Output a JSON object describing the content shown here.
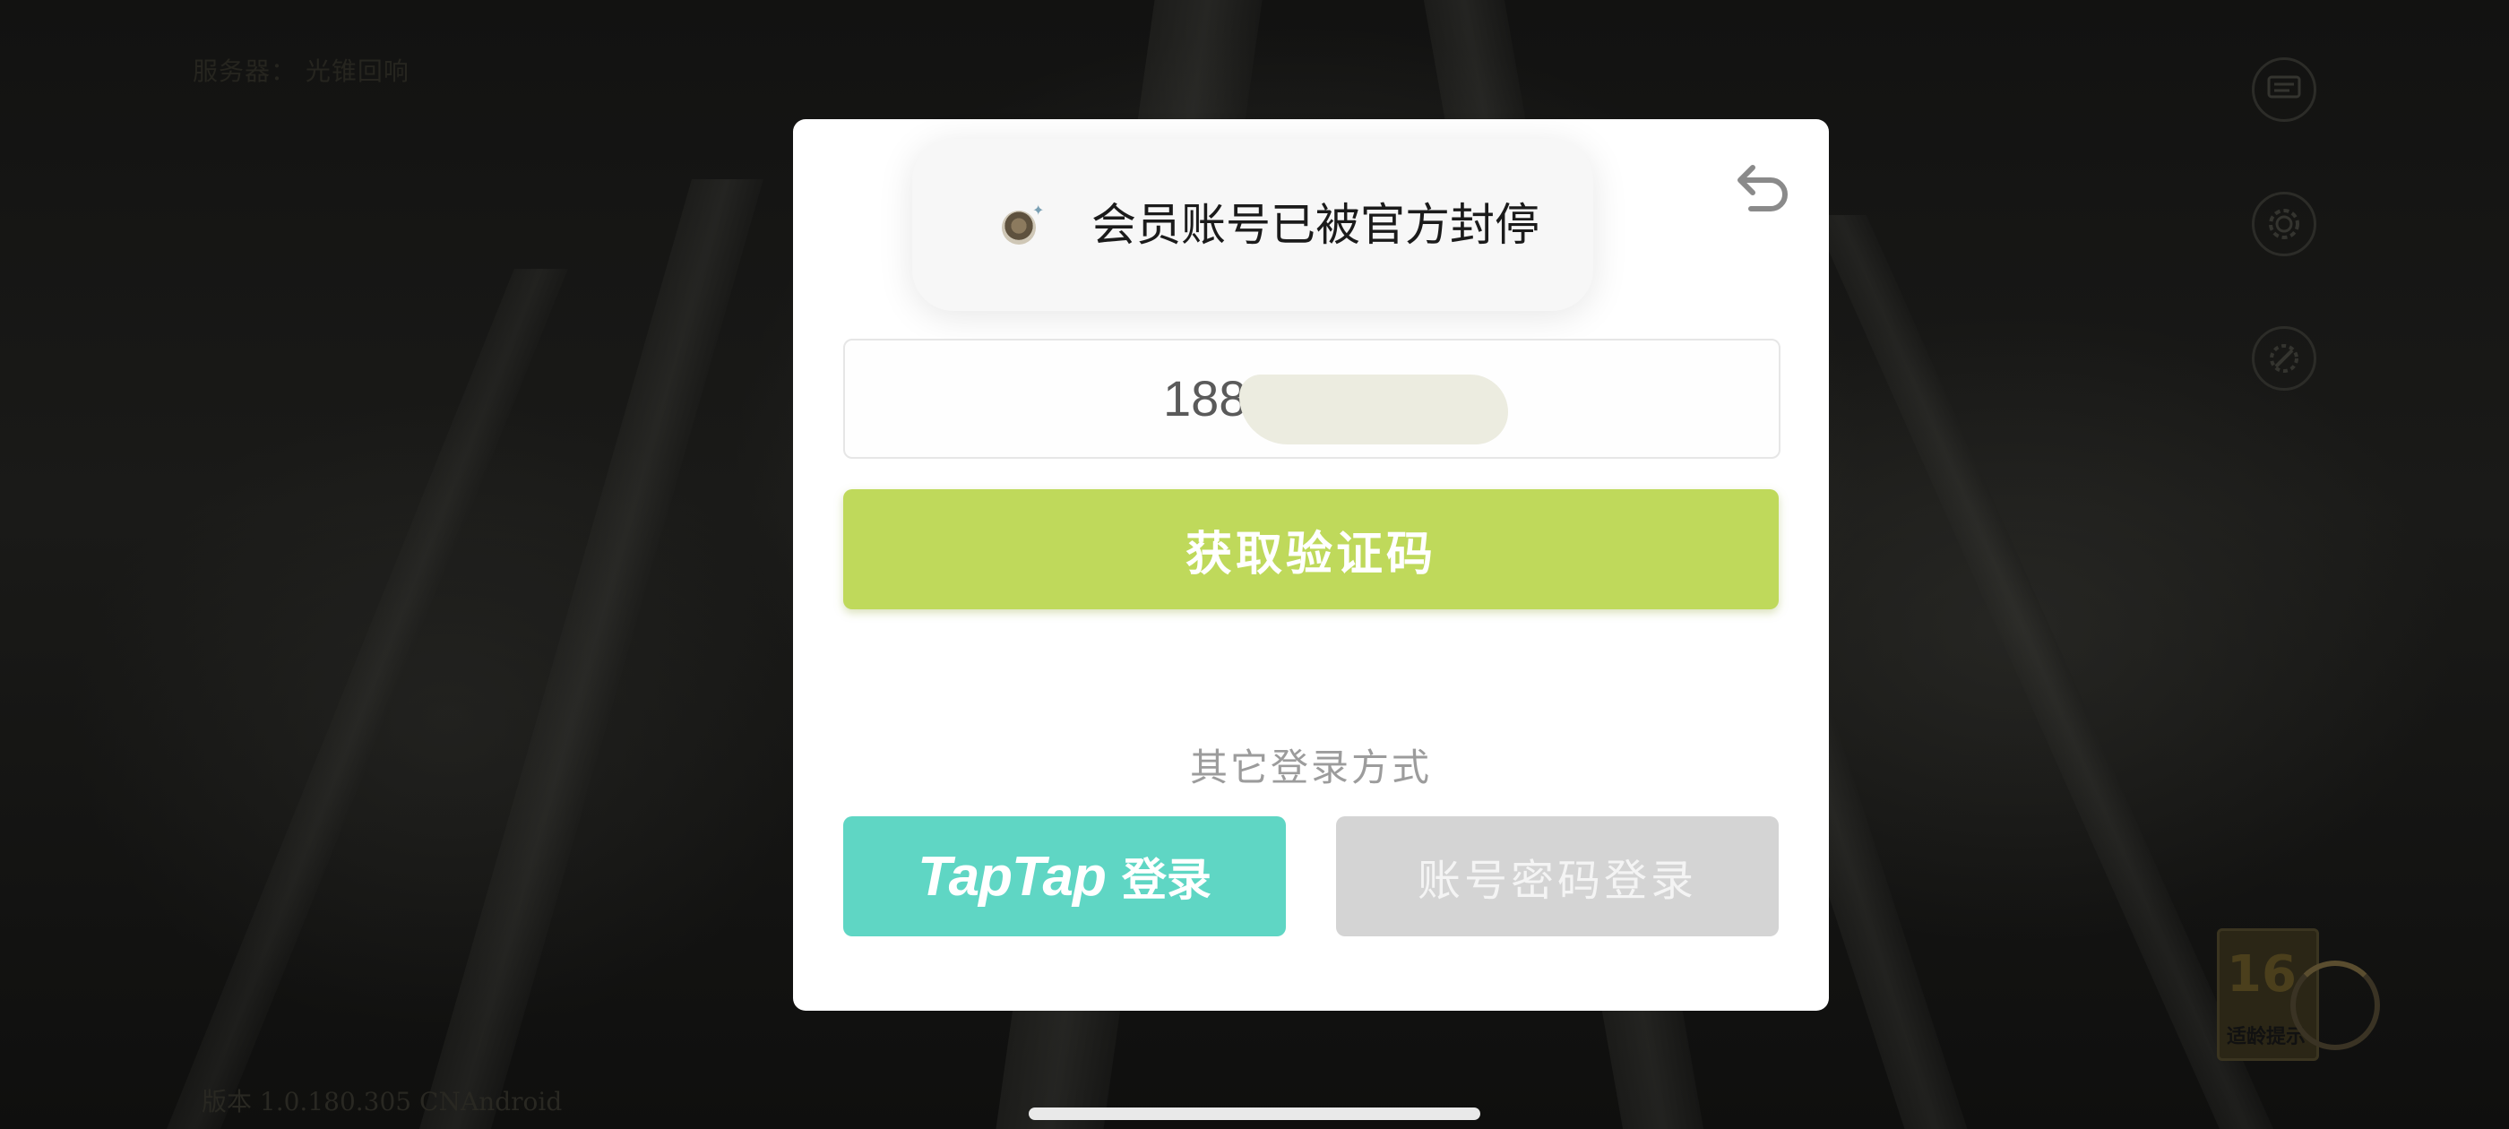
{
  "background": {
    "server_label": "服务器： 光锥回响",
    "version": "版本 1.0.180.305 CNAndroid",
    "side_icons": [
      "announcement-icon",
      "settings-gear-icon",
      "tools-icon"
    ],
    "age_rating": {
      "number": "16",
      "label": "适龄提示"
    }
  },
  "modal": {
    "toast": {
      "message": "会员账号已被官方封停"
    },
    "phone_input": {
      "value": "188"
    },
    "get_code_button": "获取验证码",
    "other_methods_label": "其它登录方式",
    "taptap_button": {
      "brand": "TapTap",
      "label": "登录"
    },
    "password_button": "账号密码登录"
  },
  "colors": {
    "accent_green": "#bfd95b",
    "taptap_teal": "#5fd6c4",
    "disabled_gray": "#d4d4d4"
  }
}
